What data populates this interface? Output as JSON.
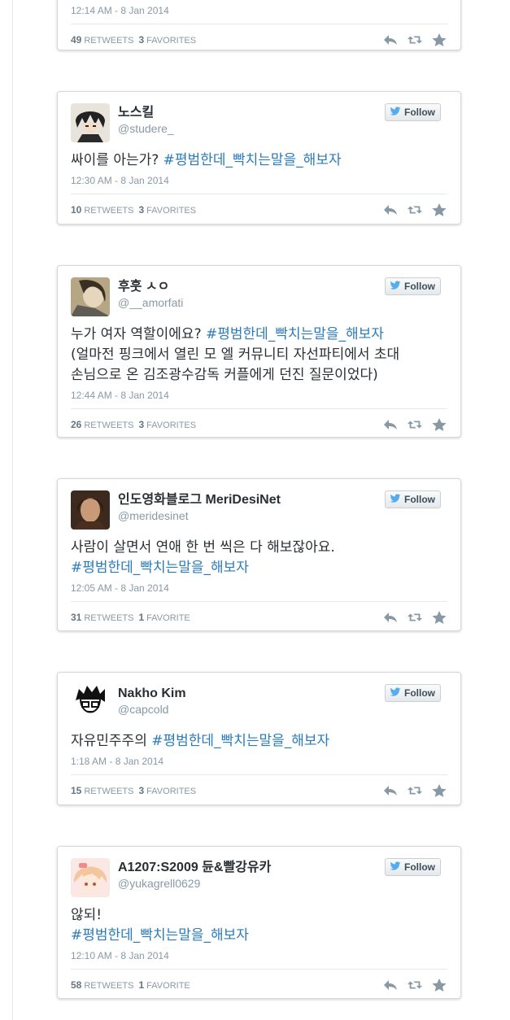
{
  "labels": {
    "follow": "Follow"
  },
  "colors": {
    "hashtag": "#2b7bb9",
    "icon": "#8899a6",
    "bird": "#55acee"
  },
  "tweets": [
    {
      "display_name": "",
      "screen_name": "",
      "lines": [],
      "timestamp": "12:14 AM - 8 Jan 2014",
      "retweets": "49",
      "retweets_label": "RETWEETS",
      "favorites": "3",
      "favorites_label": "FAVORITES"
    },
    {
      "display_name": "노스킬",
      "screen_name": "@studere_",
      "avatar_icon": "anime-boy-avatar",
      "lines": [
        [
          {
            "text": "싸이를 아는가? "
          },
          {
            "text": "#평범한데_빡치는말을_해보자",
            "tag": true
          }
        ]
      ],
      "timestamp": "12:30 AM - 8 Jan 2014",
      "retweets": "10",
      "retweets_label": "RETWEETS",
      "favorites": "3",
      "favorites_label": "FAVORITES"
    },
    {
      "display_name": "후훗 ㅅㅇ",
      "screen_name": "@__amorfati",
      "avatar_icon": "photo-avatar",
      "lines": [
        [
          {
            "text": "누가 여자 역할이에요? "
          },
          {
            "text": "#평범한데_빡치는말을_해보자",
            "tag": true
          }
        ],
        [
          {
            "text": "(얼마전 핑크에서 열린 모 엘 커뮤니티 자선파티에서 초대"
          }
        ],
        [
          {
            "text": "손님으로 온 김조광수감독 커플에게 던진 질문이었다)"
          }
        ]
      ],
      "timestamp": "12:44 AM - 8 Jan 2014",
      "retweets": "26",
      "retweets_label": "RETWEETS",
      "favorites": "3",
      "favorites_label": "FAVORITES"
    },
    {
      "display_name": "인도영화블로그 MeriDesiNet",
      "screen_name": "@meridesinet",
      "avatar_icon": "portrait-avatar",
      "lines": [
        [
          {
            "text": "사람이 살면서 연애 한 번 씩은 다 해보잖아요."
          }
        ],
        [
          {
            "text": " #평범한데_빡치는말을_해보자",
            "tag": true
          }
        ]
      ],
      "timestamp": "12:05 AM - 8 Jan 2014",
      "retweets": "31",
      "retweets_label": "RETWEETS",
      "favorites": "1",
      "favorites_label": "FAVORITE"
    },
    {
      "display_name": "Nakho Kim",
      "screen_name": "@capcold",
      "avatar_icon": "cartoon-glasses-avatar",
      "lines": [
        [
          {
            "text": "자유민주주의 "
          },
          {
            "text": "#평범한데_빡치는말을_해보자",
            "tag": true
          }
        ]
      ],
      "timestamp": "1:18 AM - 8 Jan 2014",
      "retweets": "15",
      "retweets_label": "RETWEETS",
      "favorites": "3",
      "favorites_label": "FAVORITES"
    },
    {
      "display_name": "A1207:S2009 듄&빨강유카",
      "screen_name": "@yukagrell0629",
      "avatar_icon": "anime-girl-avatar",
      "lines": [
        [
          {
            "text": "않되!"
          }
        ],
        [
          {
            "text": "#평범한데_빡치는말을_해보자",
            "tag": true
          }
        ]
      ],
      "timestamp": "12:10 AM - 8 Jan 2014",
      "retweets": "58",
      "retweets_label": "RETWEETS",
      "favorites": "1",
      "favorites_label": "FAVORITE"
    }
  ]
}
